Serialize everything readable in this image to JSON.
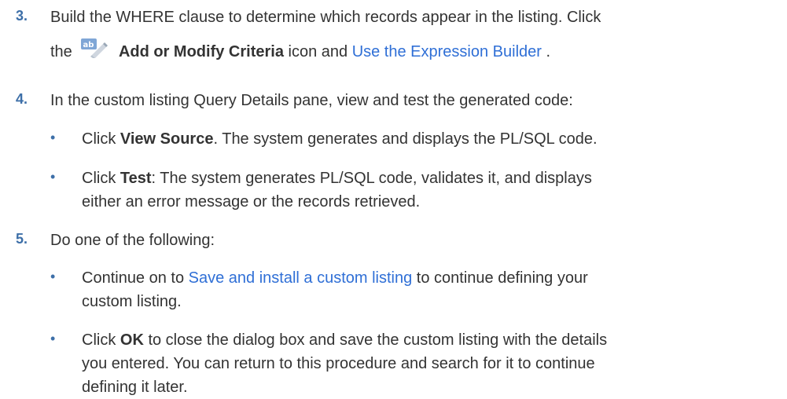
{
  "steps": [
    {
      "num": "3.",
      "line1": "Build the WHERE clause to determine which records appear in the listing. Click",
      "line2_pre": "the",
      "icon_name": "add-or-modify-criteria-icon",
      "icon_label": "Add or Modify Criteria",
      "line2_mid": " icon and ",
      "line2_link": "Use the Expression Builder",
      "line2_post": " ."
    },
    {
      "num": "4.",
      "text": "In the custom listing Query Details pane, view and test the generated code:",
      "bullets": [
        {
          "pre": "Click ",
          "bold": "View Source",
          "post": ". The system generates and displays the PL/SQL code."
        },
        {
          "pre": "Click ",
          "bold": "Test",
          "post_line1": ": The system generates PL/SQL code, validates it, and displays",
          "post_line2": "either an error message or the records retrieved."
        }
      ]
    },
    {
      "num": "5.",
      "text": "Do one of the following:",
      "bullets": [
        {
          "pre": "Continue on to ",
          "link": "Save and install a custom listing",
          "post_line1": " to continue defining your",
          "post_line2": "custom listing."
        },
        {
          "pre": "Click ",
          "bold": "OK",
          "post_line1": " to close the dialog box and save the custom listing with the details",
          "post_line2": "you entered. You can return to this procedure and search for it to continue",
          "post_line3": "defining it later."
        }
      ]
    }
  ],
  "colors": {
    "text": "#333333",
    "step_number": "#3d6fa8",
    "link": "#2f6fd6"
  }
}
